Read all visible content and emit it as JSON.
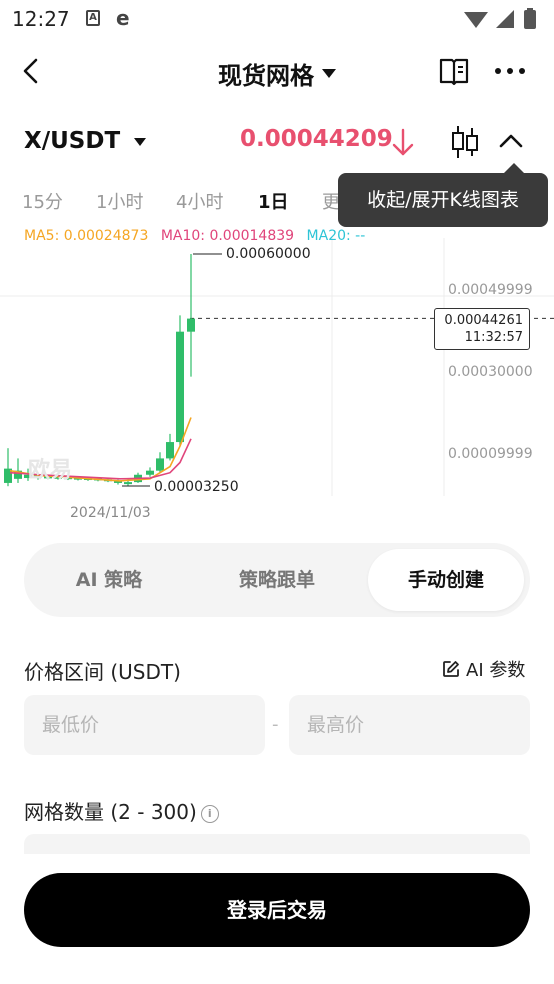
{
  "status": {
    "time": "12:27",
    "icon_a": "A",
    "icon_e": "e"
  },
  "header": {
    "title": "现货网格"
  },
  "pair": {
    "name": "X/USDT",
    "price": "0.00044209"
  },
  "tabs": [
    {
      "label": "15分",
      "active": false
    },
    {
      "label": "1小时",
      "active": false
    },
    {
      "label": "4小时",
      "active": false
    },
    {
      "label": "1日",
      "active": true
    },
    {
      "label": "更",
      "active": false
    }
  ],
  "tooltip": "收起/展开K线图表",
  "chart": {
    "ma5_label": "MA5: 0.00024873",
    "ma10_label": "MA10: 0.00014839",
    "ma20_label": "MA20: --",
    "axis": [
      "0.00049999",
      "0.00030000",
      "0.00009999"
    ],
    "high_label": "0.00060000",
    "low_label": "0.00003250",
    "current_price": "0.00044261",
    "current_time": "11:32:57",
    "date": "2024/11/03",
    "watermark": "欧易"
  },
  "chart_data": {
    "type": "candlestick",
    "x": [
      "2024/11/03"
    ],
    "y_ticks": [
      0.00049999,
      0.0003,
      9.999e-05
    ],
    "high": 0.0006,
    "low": 3.25e-05,
    "current": 0.00044261,
    "series": [
      {
        "name": "MA5",
        "color": "#f5a623"
      },
      {
        "name": "MA10",
        "color": "#e0457b"
      },
      {
        "name": "MA20",
        "color": "#2ec4d6"
      }
    ]
  },
  "segment": {
    "items": [
      "AI 策略",
      "策略跟单",
      "手动创建"
    ],
    "active_index": 2
  },
  "price_range": {
    "title": "价格区间 (USDT)",
    "ai_param": "AI 参数",
    "min_placeholder": "最低价",
    "max_placeholder": "最高价",
    "separator": "-"
  },
  "grid_count": {
    "title": "网格数量 (2 - 300)",
    "info": "i"
  },
  "login_button": "登录后交易",
  "colors": {
    "price_down": "#e8506f",
    "candle_up": "#2fbd69",
    "ma5": "#f5a623",
    "ma10": "#e0457b",
    "ma20": "#2ec4d6"
  }
}
